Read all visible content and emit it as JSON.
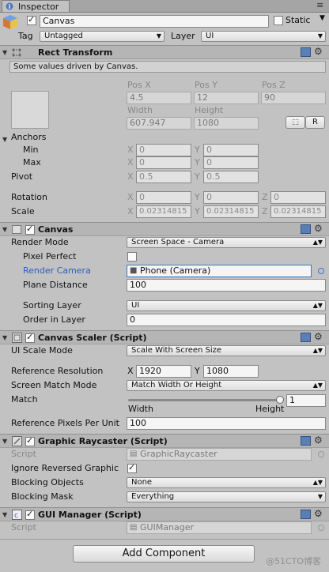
{
  "window": {
    "tab_label": "Inspector"
  },
  "gameobject": {
    "name": "Canvas",
    "active": true,
    "static_label": "Static",
    "tag_label": "Tag",
    "tag_value": "Untagged",
    "layer_label": "Layer",
    "layer_value": "UI"
  },
  "rect_transform": {
    "title": "Rect Transform",
    "hint": "Some values driven by Canvas.",
    "pos_x_label": "Pos X",
    "pos_y_label": "Pos Y",
    "pos_z_label": "Pos Z",
    "pos_x": "4.5",
    "pos_y": "12",
    "pos_z": "90",
    "width_label": "Width",
    "height_label": "Height",
    "width": "607.947",
    "height": "1080",
    "r_button": "R",
    "anchors_label": "Anchors",
    "min_label": "Min",
    "max_label": "Max",
    "min_x": "0",
    "min_y": "0",
    "max_x": "0",
    "max_y": "0",
    "pivot_label": "Pivot",
    "pivot_x": "0.5",
    "pivot_y": "0.5",
    "rotation_label": "Rotation",
    "rot_x": "0",
    "rot_y": "0",
    "rot_z": "0",
    "scale_label": "Scale",
    "scale_x": "0.02314815",
    "scale_y": "0.02314815",
    "scale_z": "0.02314815",
    "axis_x": "X",
    "axis_y": "Y",
    "axis_z": "Z"
  },
  "canvas": {
    "title": "Canvas",
    "enabled": true,
    "render_mode_label": "Render Mode",
    "render_mode_value": "Screen Space - Camera",
    "pixel_perfect_label": "Pixel Perfect",
    "pixel_perfect": false,
    "render_camera_label": "Render Camera",
    "render_camera_value": "Phone (Camera)",
    "plane_distance_label": "Plane Distance",
    "plane_distance_value": "100",
    "sorting_layer_label": "Sorting Layer",
    "sorting_layer_value": "UI",
    "order_label": "Order in Layer",
    "order_value": "0"
  },
  "canvas_scaler": {
    "title": "Canvas Scaler (Script)",
    "enabled": true,
    "ui_scale_mode_label": "UI Scale Mode",
    "ui_scale_mode_value": "Scale With Screen Size",
    "ref_res_label": "Reference Resolution",
    "ref_res_x": "1920",
    "ref_res_y": "1080",
    "match_mode_label": "Screen Match Mode",
    "match_mode_value": "Match Width Or Height",
    "match_label": "Match",
    "match_value": "1",
    "match_fraction": 1,
    "width_caption": "Width",
    "height_caption": "Height",
    "ref_ppu_label": "Reference Pixels Per Unit",
    "ref_ppu_value": "100"
  },
  "graphic_raycaster": {
    "title": "Graphic Raycaster (Script)",
    "enabled": true,
    "script_label": "Script",
    "script_value": "GraphicRaycaster",
    "ignore_reversed_label": "Ignore Reversed Graphic",
    "ignore_reversed": true,
    "blocking_objects_label": "Blocking Objects",
    "blocking_objects_value": "None",
    "blocking_mask_label": "Blocking Mask",
    "blocking_mask_value": "Everything"
  },
  "gui_manager": {
    "title": "GUI Manager (Script)",
    "enabled": true,
    "script_label": "Script",
    "script_value": "GUIManager"
  },
  "footer": {
    "add_component": "Add Component",
    "watermark": "@51CTO博客"
  },
  "colors": {
    "panel_bg": "#c2c2c2",
    "header_bg": "#b5b5b5",
    "selected_text": "#2c5fb5",
    "selected_border": "#3a76d6"
  }
}
